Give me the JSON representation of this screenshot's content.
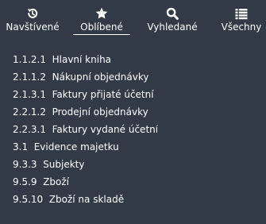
{
  "tabs": [
    {
      "label": "Navštívené",
      "icon": "history-icon"
    },
    {
      "label": "Oblíbené",
      "icon": "star-icon",
      "active": true
    },
    {
      "label": "Vyhledané",
      "icon": "search-icon"
    },
    {
      "label": "Všechny",
      "icon": "list-icon"
    }
  ],
  "favorites": [
    {
      "label": "1.1.2.1  Hlavní kniha"
    },
    {
      "label": "2.1.1.2  Nákupní objednávky"
    },
    {
      "label": "2.1.3.1  Faktury přijaté účetní"
    },
    {
      "label": "2.2.1.2  Prodejní objednávky"
    },
    {
      "label": "2.2.3.1  Faktury vydané účetní"
    },
    {
      "label": "3.1  Evidence majetku"
    },
    {
      "label": "9.3.3  Subjekty"
    },
    {
      "label": "9.5.9  Zboží"
    },
    {
      "label": "9.5.10  Zboží na skladě"
    }
  ],
  "colors": {
    "background": "#323a48",
    "text": "#ffffff"
  }
}
